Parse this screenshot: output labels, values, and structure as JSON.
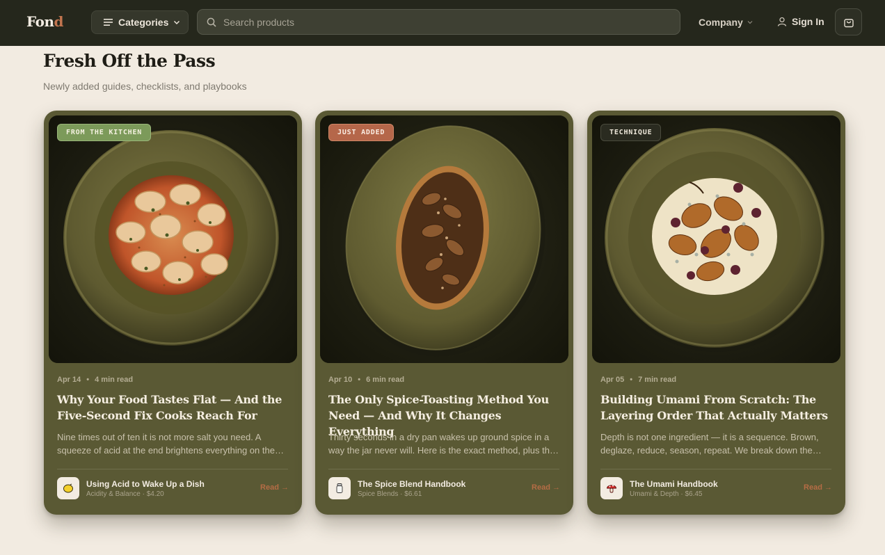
{
  "nav": {
    "logo_main": "Fon",
    "logo_accent": "d",
    "categories_label": "Categories",
    "search_placeholder": "Search products",
    "company_label": "Company",
    "signin_label": "Sign In"
  },
  "section": {
    "title": "Fresh Off the Pass",
    "subtitle": "Newly added guides, checklists, and playbooks"
  },
  "cards": [
    {
      "tag": "FROM THE KITCHEN",
      "tag_bg": "#7c9a5a",
      "tag_color": "#f3f0df",
      "image": "dumplings-dish",
      "date": "Apr 14",
      "read_time": "4 min read",
      "title": "Why Your Food Tastes Flat — And the Five-Second Fix Cooks Reach For",
      "excerpt": "Nine times out of ten it is not more salt you need. A squeeze of acid at the end brightens everything on the plate.",
      "product_icon": "lemon-icon",
      "product_name": "Using Acid to Wake Up a Dish",
      "product_sub": "Acidity & Balance · $4.20",
      "read_label": "Read →"
    },
    {
      "tag": "JUST ADDED",
      "tag_bg": "#b5674a",
      "tag_color": "#fbeee4",
      "image": "mushroom-tart",
      "date": "Apr 10",
      "read_time": "6 min read",
      "title": "The Only Spice-Toasting Method You Need — And Why It Changes Everything",
      "excerpt": "Thirty seconds in a dry pan wakes up ground spice in a way the jar never will. Here is the exact method, plus the timing.",
      "product_icon": "spice-jar-icon",
      "product_name": "The Spice Blend Handbook",
      "product_sub": "Spice Blends · $6.61",
      "read_label": "Read →"
    },
    {
      "tag": "TECHNIQUE",
      "tag_bg": "#2a2b20",
      "tag_color": "#ece6d8",
      "image": "pear-dish",
      "date": "Apr 05",
      "read_time": "7 min read",
      "title": "Building Umami From Scratch: The Layering Order That Actually Matters",
      "excerpt": "Depth is not one ingredient — it is a sequence. Brown, deglaze, reduce, season, repeat. We break down the layering order.",
      "product_icon": "mushroom-icon",
      "product_name": "The Umami Handbook",
      "product_sub": "Umami & Depth · $6.45",
      "read_label": "Read →"
    }
  ]
}
